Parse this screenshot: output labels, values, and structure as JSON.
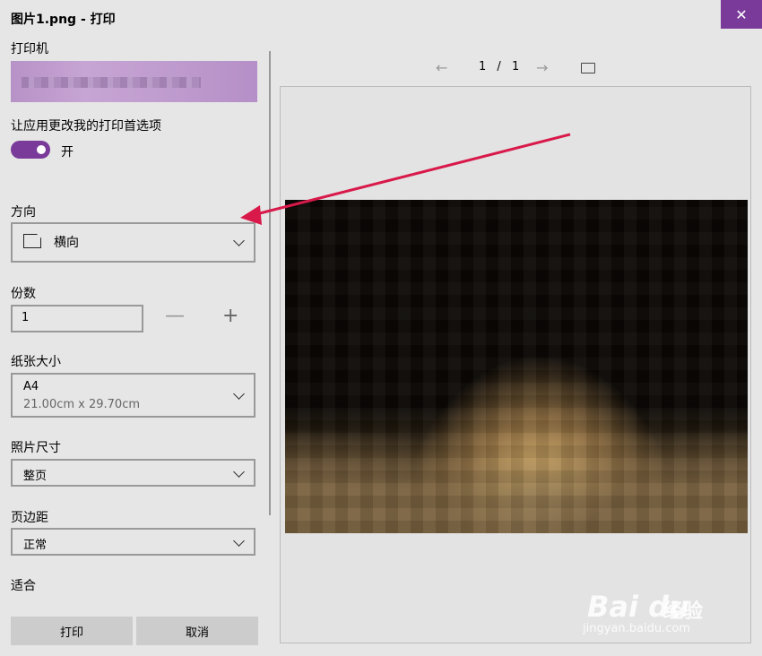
{
  "window": {
    "title": "图片1.png - 打印",
    "close_glyph": "✕"
  },
  "printer": {
    "label": "打印机",
    "value": ""
  },
  "allow_app": {
    "label": "让应用更改我的打印首选项",
    "toggle_state": "开",
    "on": true
  },
  "orientation": {
    "label": "方向",
    "value": "横向"
  },
  "copies": {
    "label": "份数",
    "value": "1",
    "minus": "—",
    "plus": "+"
  },
  "paper_size": {
    "label": "纸张大小",
    "value": "A4",
    "detail": "21.00cm x 29.70cm"
  },
  "photo_size": {
    "label": "照片尺寸",
    "value": "整页"
  },
  "margins": {
    "label": "页边距",
    "value": "正常"
  },
  "fit": {
    "label": "适合"
  },
  "buttons": {
    "print": "打印",
    "cancel": "取消"
  },
  "preview": {
    "current_page": "1",
    "separator": "/",
    "total_pages": "1",
    "prev_glyph": "←",
    "next_glyph": "→"
  },
  "watermark": {
    "logo": "Bai du",
    "brand": "经验",
    "url": "jingyan.baidu.com"
  },
  "colors": {
    "accent": "#7a3a9a",
    "annotation_arrow": "#d8194a"
  },
  "icons": [
    "close-icon",
    "page-orientation-icon",
    "chevron-down-icon",
    "minus-icon",
    "plus-icon",
    "prev-page-icon",
    "next-page-icon",
    "fit-page-icon"
  ]
}
